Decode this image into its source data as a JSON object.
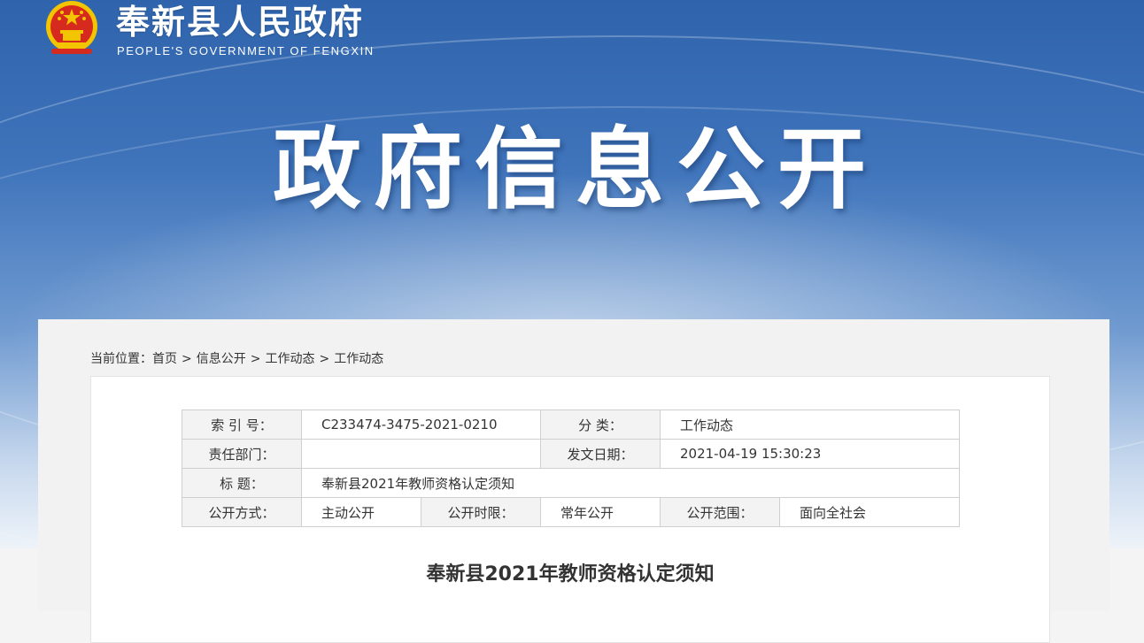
{
  "header": {
    "site_title": "奉新县人民政府",
    "site_subtitle": "PEOPLE'S GOVERNMENT OF FENGXIN",
    "hero_title": "政府信息公开"
  },
  "breadcrumb": {
    "prefix": "当前位置：",
    "items": [
      "首页",
      "信息公开",
      "工作动态",
      "工作动态"
    ],
    "separator": ">"
  },
  "meta": {
    "index_label": "索 引 号：",
    "index_value": "C233474-3475-2021-0210",
    "category_label": "分    类：",
    "category_value": "工作动态",
    "dept_label": "责任部门：",
    "dept_value": "",
    "date_label": "发文日期：",
    "date_value": "2021-04-19 15:30:23",
    "title_label": "标    题：",
    "title_value": "奉新县2021年教师资格认定须知",
    "mode_label": "公开方式：",
    "mode_value": "主动公开",
    "period_label": "公开时限：",
    "period_value": "常年公开",
    "scope_label": "公开范围：",
    "scope_value": "面向全社会"
  },
  "document": {
    "title": "奉新县2021年教师资格认定须知"
  },
  "colors": {
    "banner_top": "#2f64ad",
    "emblem_red": "#d62a1e",
    "emblem_gold": "#f2c500"
  }
}
